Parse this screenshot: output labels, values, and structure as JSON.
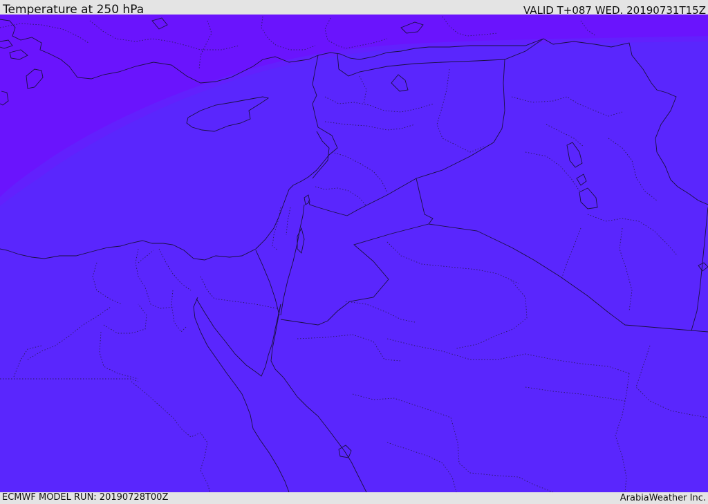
{
  "header": {
    "title": "Temperature at 250 hPa",
    "valid": "VALID T+087 WED. 20190731T15Z"
  },
  "footer": {
    "model_run": "ECMWF MODEL RUN: 20190728T00Z",
    "credit": "ArabiaWeather Inc."
  },
  "colors": {
    "field_main": "#5a26fd",
    "field_cold": "#6a14fd",
    "field_edge": "#6220fd",
    "coastline": "#1a1040",
    "background": "#e4e4e4"
  }
}
